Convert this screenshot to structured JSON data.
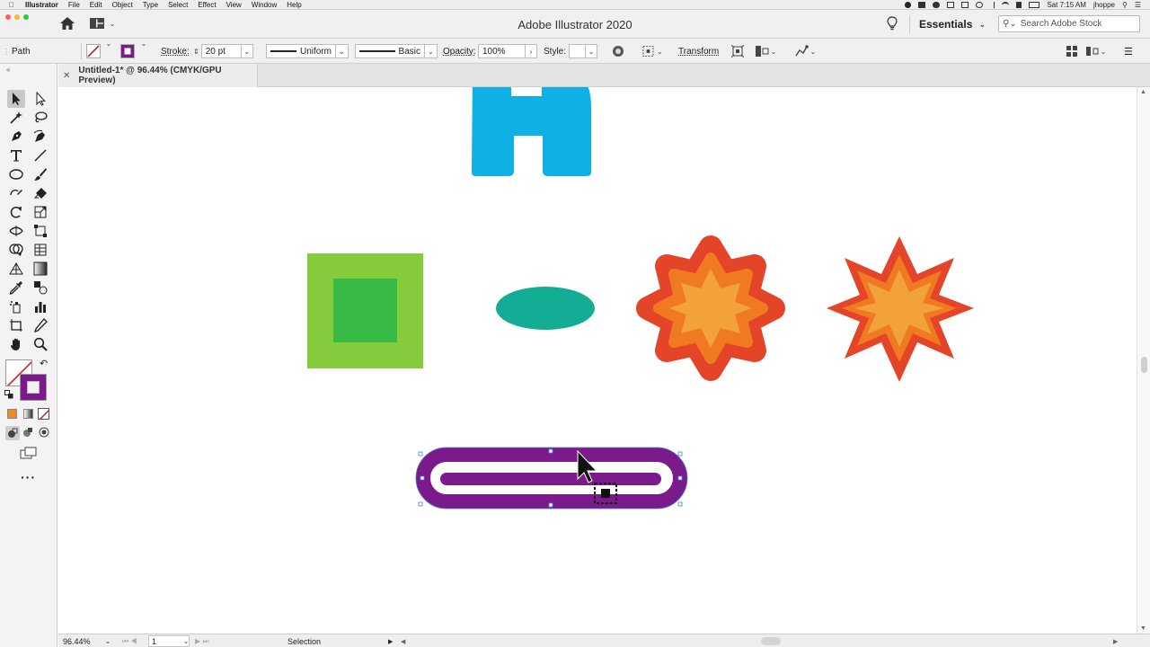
{
  "menubar": {
    "app_name": "Illustrator",
    "items": [
      "File",
      "Edit",
      "Object",
      "Type",
      "Select",
      "Effect",
      "View",
      "Window",
      "Help"
    ],
    "clock": "Sat 7:15 AM",
    "user": "jhoppe"
  },
  "titlebar": {
    "title": "Adobe Illustrator 2020",
    "workspace": "Essentials",
    "search_placeholder": "Search Adobe Stock"
  },
  "control": {
    "selection_type": "Path",
    "stroke_label": "Stroke:",
    "stroke_weight": "20 pt",
    "variable_width": "Uniform",
    "brush": "Basic",
    "opacity_label": "Opacity:",
    "opacity_value": "100%",
    "style_label": "Style:",
    "transform_label": "Transform",
    "stroke_color": "#7b1a8a"
  },
  "document": {
    "tab_title": "Untitled-1* @ 96.44% (CMYK/GPU Preview)"
  },
  "colors": {
    "fill_none": "#ffffff",
    "stroke_purple": "#7b1a8a",
    "blue_letter": "#0fb0e6",
    "light_green": "#84cc3b",
    "dark_green": "#37bb46",
    "teal": "#13ad95",
    "burst_red": "#e44427",
    "burst_orange": "#f07a22",
    "burst_yellow": "#f2a23b"
  },
  "status": {
    "zoom": "96.44%",
    "artboard": "1",
    "tool": "Selection"
  }
}
